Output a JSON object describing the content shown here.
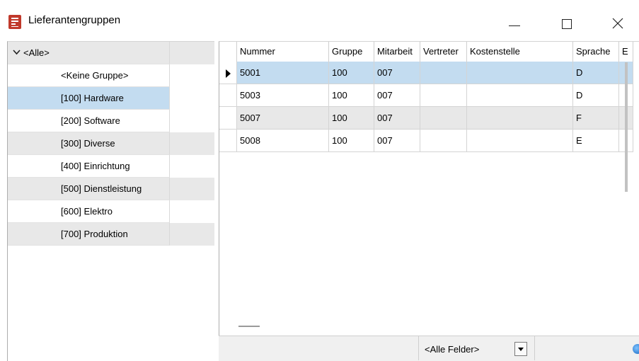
{
  "window": {
    "title": "Lieferantengruppen",
    "controls": {
      "minimize": "—",
      "maximize": "☐",
      "close": "✕"
    }
  },
  "tree": {
    "root": "<Alle>",
    "items": [
      {
        "label": "<Keine Gruppe>",
        "selected": false,
        "alt": false
      },
      {
        "label": "[100] Hardware",
        "selected": true,
        "alt": false
      },
      {
        "label": "[200] Software",
        "selected": false,
        "alt": false
      },
      {
        "label": "[300] Diverse",
        "selected": false,
        "alt": true
      },
      {
        "label": "[400] Einrichtung",
        "selected": false,
        "alt": false
      },
      {
        "label": "[500] Dienstleistung",
        "selected": false,
        "alt": true
      },
      {
        "label": "[600] Elektro",
        "selected": false,
        "alt": false
      },
      {
        "label": "[700] Produktion",
        "selected": false,
        "alt": true
      }
    ]
  },
  "grid": {
    "columns": [
      "Nummer",
      "Gruppe",
      "Mitarbeit",
      "Vertreter",
      "Kostenstelle",
      "Sprache",
      "E"
    ],
    "rows": [
      [
        "5001",
        "100",
        "007",
        "",
        "",
        "D",
        ""
      ],
      [
        "5003",
        "100",
        "007",
        "",
        "",
        "D",
        ""
      ],
      [
        "5007",
        "100",
        "007",
        "",
        "",
        "F",
        ""
      ],
      [
        "5008",
        "100",
        "007",
        "",
        "",
        "E",
        ""
      ]
    ],
    "current_row_marker": "▶"
  },
  "filter": {
    "field_select": "<Alle Felder>"
  },
  "colors": {
    "selection": "#c3dcf0",
    "alternate_row": "#e8e8e8",
    "accent_icon": "#c0392b"
  }
}
